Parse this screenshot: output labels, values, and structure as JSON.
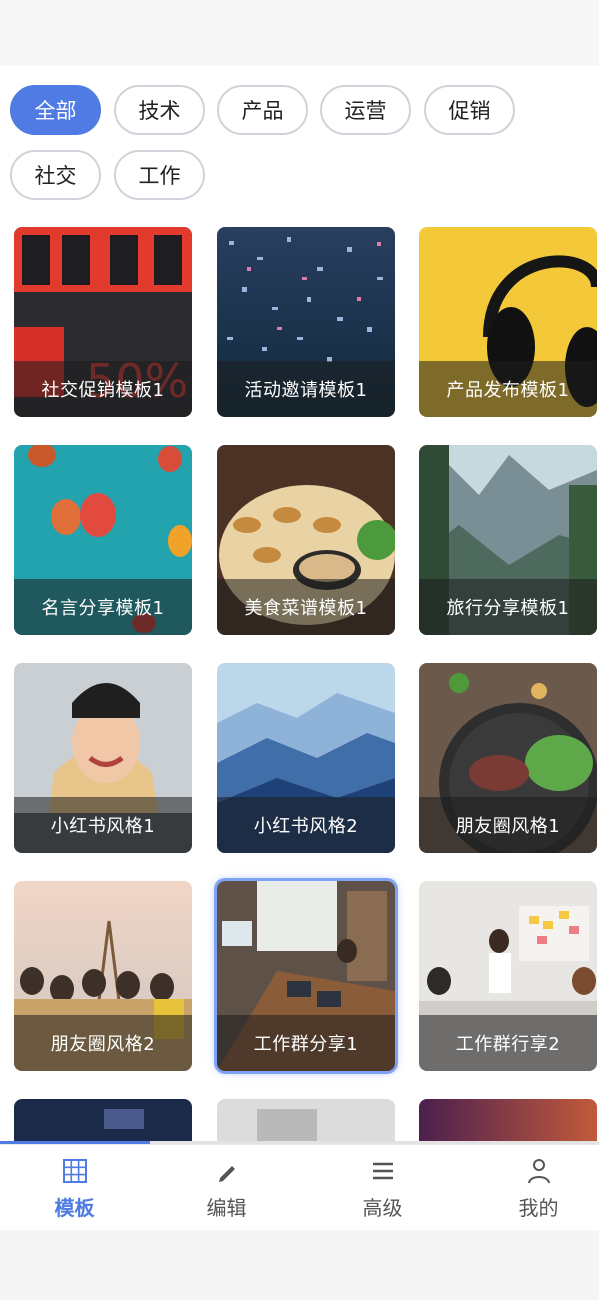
{
  "categories": {
    "items": [
      "全部",
      "技术",
      "产品",
      "运营",
      "促销",
      "社交",
      "工作"
    ],
    "selected": "全部"
  },
  "templates": [
    {
      "title": "社交促销模板1",
      "image": "sale-bag-photo"
    },
    {
      "title": "活动邀请模板1",
      "image": "confetti-photo"
    },
    {
      "title": "产品发布模板1",
      "image": "headphones-photo"
    },
    {
      "title": "名言分享模板1",
      "image": "hot-air-balloons-photo"
    },
    {
      "title": "美食菜谱模板1",
      "image": "food-platter-photo"
    },
    {
      "title": "旅行分享模板1",
      "image": "mountain-valley-photo"
    },
    {
      "title": "小红书风格1",
      "image": "smiling-woman-photo"
    },
    {
      "title": "小红书风格2",
      "image": "blue-mountains-photo"
    },
    {
      "title": "朋友圈风格1",
      "image": "salad-bowl-photo"
    },
    {
      "title": "朋友圈风格2",
      "image": "friends-sunset-photo"
    },
    {
      "title": "工作群分享1",
      "image": "office-meeting-photo",
      "selected": true
    },
    {
      "title": "工作群行享2",
      "image": "whiteboard-meeting-photo"
    }
  ],
  "peek_row": [
    "dark-screen-photo",
    "office-desk-photo",
    "purple-gradient-photo"
  ],
  "scroll_progress": 0.25,
  "tabbar": {
    "tabs": [
      {
        "label": "模板",
        "icon": "grid-icon"
      },
      {
        "label": "编辑",
        "icon": "pencil-icon"
      },
      {
        "label": "高级",
        "icon": "menu-lines-icon"
      },
      {
        "label": "我的",
        "icon": "user-icon"
      }
    ],
    "active": "模板"
  },
  "colors": {
    "accent": "#4f7be2",
    "chip_border": "#cfd3d9"
  }
}
